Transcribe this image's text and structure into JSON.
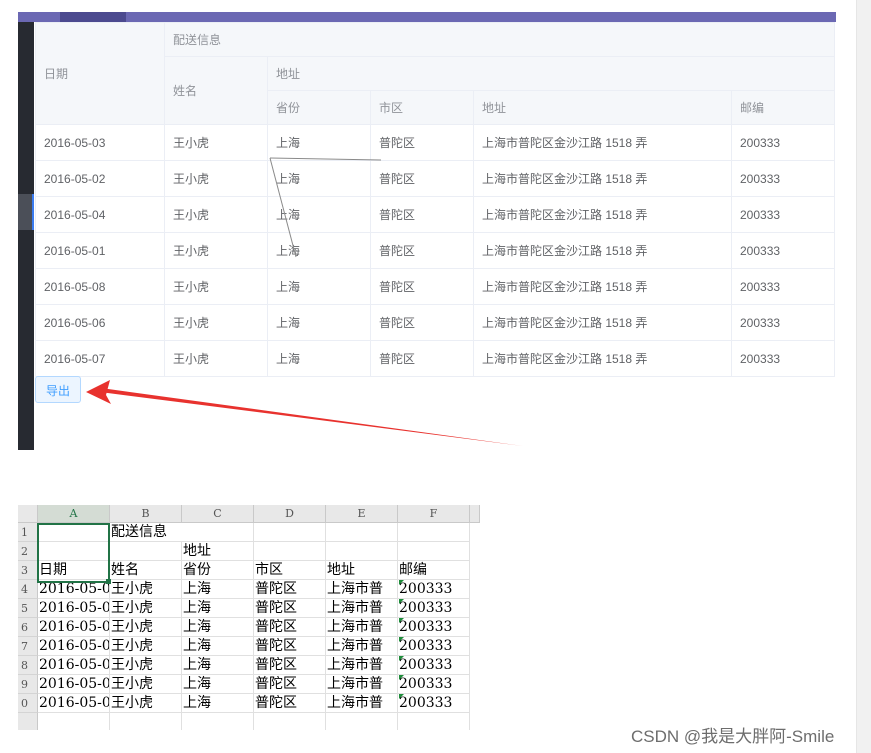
{
  "webTable": {
    "group_header": "配送信息",
    "date_header": "日期",
    "name_header": "姓名",
    "address_group": "地址",
    "province_header": "省份",
    "city_header": "市区",
    "address_header": "地址",
    "zip_header": "邮编",
    "rows": [
      {
        "date": "2016-05-03",
        "name": "王小虎",
        "province": "上海",
        "city": "普陀区",
        "address": "上海市普陀区金沙江路 1518 弄",
        "zip": "200333"
      },
      {
        "date": "2016-05-02",
        "name": "王小虎",
        "province": "上海",
        "city": "普陀区",
        "address": "上海市普陀区金沙江路 1518 弄",
        "zip": "200333"
      },
      {
        "date": "2016-05-04",
        "name": "王小虎",
        "province": "上海",
        "city": "普陀区",
        "address": "上海市普陀区金沙江路 1518 弄",
        "zip": "200333"
      },
      {
        "date": "2016-05-01",
        "name": "王小虎",
        "province": "上海",
        "city": "普陀区",
        "address": "上海市普陀区金沙江路 1518 弄",
        "zip": "200333"
      },
      {
        "date": "2016-05-08",
        "name": "王小虎",
        "province": "上海",
        "city": "普陀区",
        "address": "上海市普陀区金沙江路 1518 弄",
        "zip": "200333"
      },
      {
        "date": "2016-05-06",
        "name": "王小虎",
        "province": "上海",
        "city": "普陀区",
        "address": "上海市普陀区金沙江路 1518 弄",
        "zip": "200333"
      },
      {
        "date": "2016-05-07",
        "name": "王小虎",
        "province": "上海",
        "city": "普陀区",
        "address": "上海市普陀区金沙江路 1518 弄",
        "zip": "200333"
      }
    ],
    "export_label": "导出"
  },
  "arrow": {
    "color": "#e8322e",
    "icon": "red-arrow"
  },
  "spreadsheet": {
    "columns": [
      "A",
      "B",
      "C",
      "D",
      "E",
      "F"
    ],
    "row_numbers": [
      "1",
      "2",
      "3",
      "4",
      "5",
      "6",
      "7",
      "8",
      "9",
      "0"
    ],
    "r1_b": "配送信息",
    "r2_c": "地址",
    "r3": [
      "日期",
      "姓名",
      "省份",
      "市区",
      "地址",
      "邮编"
    ],
    "data_rows": [
      [
        "2016-05-0",
        "王小虎",
        "上海",
        "普陀区",
        "上海市普",
        "200333"
      ],
      [
        "2016-05-0",
        "王小虎",
        "上海",
        "普陀区",
        "上海市普",
        "200333"
      ],
      [
        "2016-05-0",
        "王小虎",
        "上海",
        "普陀区",
        "上海市普",
        "200333"
      ],
      [
        "2016-05-0",
        "王小虎",
        "上海",
        "普陀区",
        "上海市普",
        "200333"
      ],
      [
        "2016-05-0",
        "王小虎",
        "上海",
        "普陀区",
        "上海市普",
        "200333"
      ],
      [
        "2016-05-0",
        "王小虎",
        "上海",
        "普陀区",
        "上海市普",
        "200333"
      ],
      [
        "2016-05-0",
        "王小虎",
        "上海",
        "普陀区",
        "上海市普",
        "200333"
      ]
    ]
  },
  "watermark": "CSDN @我是大胖阿-Smile",
  "colors": {
    "accent": "#409eff",
    "topbar": "#6b68b3",
    "excel_green": "#217346"
  }
}
